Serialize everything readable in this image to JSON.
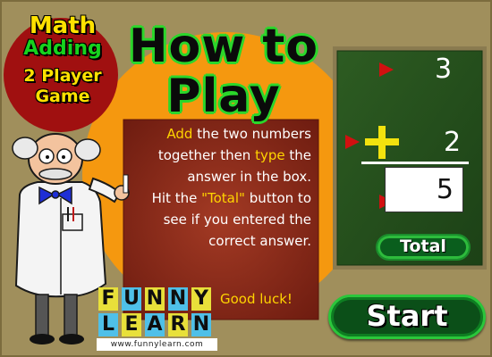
{
  "logo": {
    "math": "Math",
    "adding": "Adding",
    "players": "2 Player",
    "game": "Game"
  },
  "title": {
    "line1": "How to",
    "line2": "Play"
  },
  "instructions": {
    "add": "Add",
    "l1": " the two numbers",
    "l2a": "together then ",
    "type": "type",
    "l2b": " the",
    "l3": "answer in the box.",
    "l4a": "Hit the ",
    "total_quote": "\"Total\"",
    "l4b": " button to",
    "l5": "see if you entered the",
    "l6": "correct answer."
  },
  "example": {
    "top_number": "3",
    "operator": "+",
    "bottom_number": "2",
    "answer": "5"
  },
  "buttons": {
    "total": "Total",
    "start": "Start"
  },
  "brand": {
    "letters_row1": [
      "F",
      "U",
      "N",
      "N",
      "Y"
    ],
    "letters_row2": [
      "L",
      "E",
      "A",
      "R",
      "N"
    ],
    "tile_colors": [
      "#e8e03a",
      "#4fc0e8",
      "#e8e03a",
      "#4fc0e8",
      "#e8e03a"
    ],
    "url": "www.funnylearn.com",
    "good_luck": "Good luck!"
  },
  "colors": {
    "background": "#a08f5c",
    "orange_circle": "#f5980f",
    "red_panel": "#8e2a17",
    "chalkboard": "#264f1c",
    "button_green": "#2ac63b",
    "highlight_yellow": "#ffd400",
    "title_green": "#2bd62b"
  }
}
